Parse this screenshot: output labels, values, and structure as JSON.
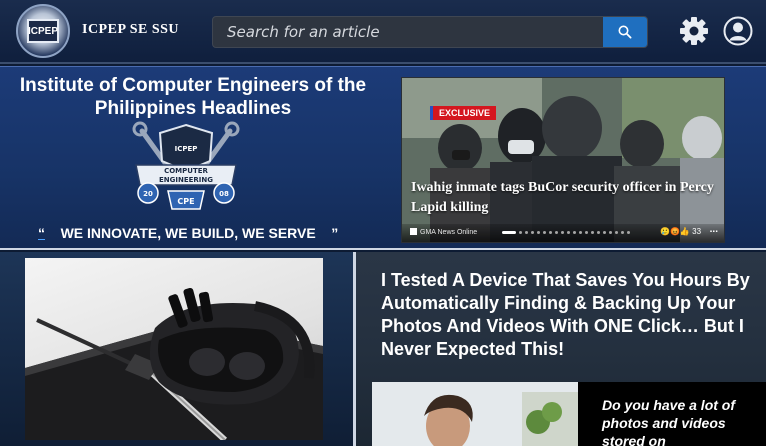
{
  "header": {
    "logo_text": "ICPEP",
    "brand": "ICPEP SE SSU",
    "search": {
      "placeholder": "Search for an article",
      "value": ""
    },
    "icons": [
      "search-icon",
      "gear-icon",
      "user-icon"
    ]
  },
  "hero": {
    "title": "Institute of Computer Engineers of the Philippines Headlines",
    "emblem_text": [
      "ICPEP",
      "COMPUTER",
      "ENGINEERING",
      "20",
      "08"
    ],
    "motto": {
      "open_quote": "“",
      "text": "WE INNOVATE, WE BUILD, WE SERVE",
      "close_quote": "”"
    },
    "news_card": {
      "badge": "EXCLUSIVE",
      "headline": "Iwahig inmate tags BuCor security officer in Percy Lapid killing",
      "source": "GMA News Online",
      "reaction_count": "33",
      "reaction_emojis": "🥲😡👍",
      "more_label": "...",
      "slide_count": 20,
      "active_slide": 0
    }
  },
  "lower": {
    "ad": {
      "title": "I Tested A Device That Saves You Hours By Automatically Finding & Backing Up Your Photos And Videos With ONE Click… But I Never Expected This!",
      "teaser": "Do you have a lot of photos and videos stored on"
    }
  },
  "colors": {
    "header_bg": "#0f1f3d",
    "hero_bg": "#173366",
    "accent_blue": "#1f6fbf",
    "badge_red": "#d4161f"
  }
}
